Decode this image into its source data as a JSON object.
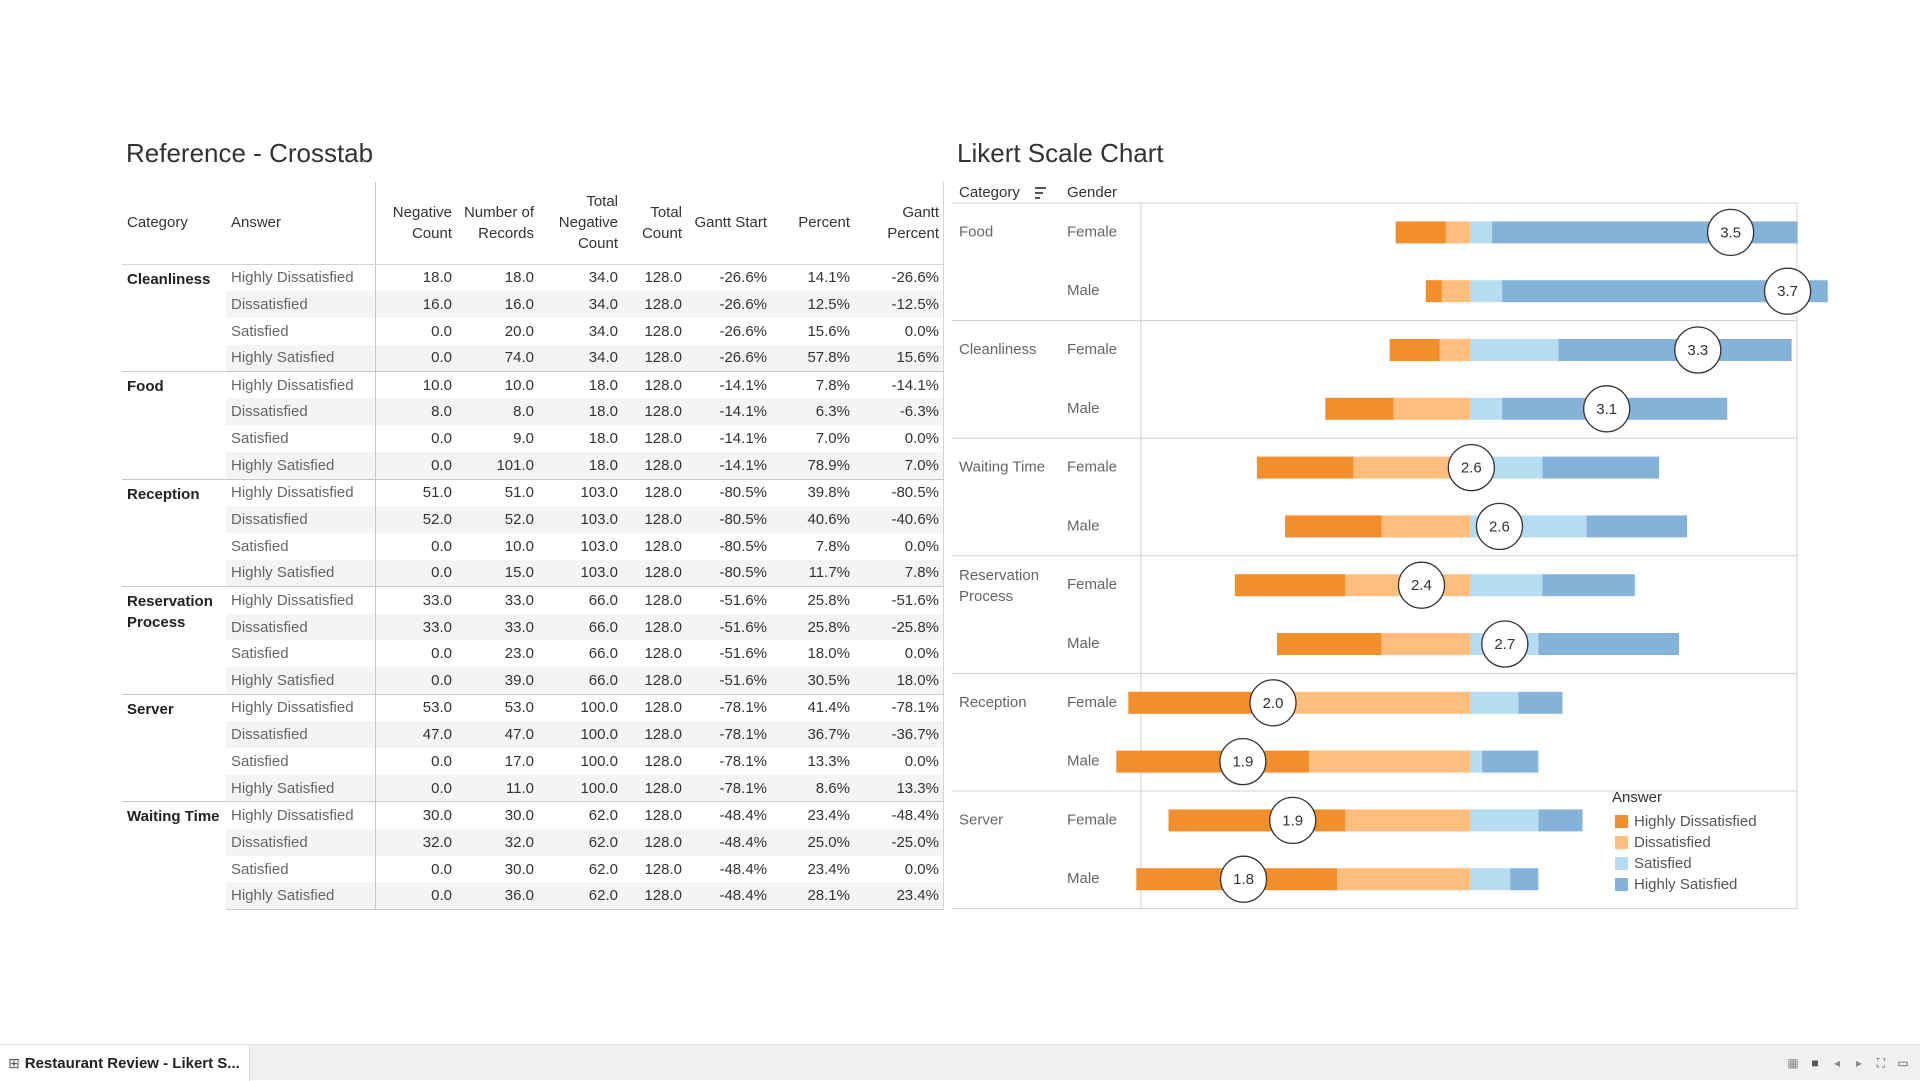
{
  "crosstab": {
    "title": "Reference - Crosstab",
    "headers": {
      "category": "Category",
      "answer": "Answer",
      "negative_count": "Negative Count",
      "number_of_records": "Number of Records",
      "total_negative_count": "Total Negative Count",
      "total_count": "Total Count",
      "gantt_start": "Gantt Start",
      "percent": "Percent",
      "gantt_percent": "Gantt Percent"
    },
    "groups": [
      {
        "category": "Cleanliness",
        "rows": [
          [
            "Highly Dissatisfied",
            "18.0",
            "18.0",
            "34.0",
            "128.0",
            "-26.6%",
            "14.1%",
            "-26.6%"
          ],
          [
            "Dissatisfied",
            "16.0",
            "16.0",
            "34.0",
            "128.0",
            "-26.6%",
            "12.5%",
            "-12.5%"
          ],
          [
            "Satisfied",
            "0.0",
            "20.0",
            "34.0",
            "128.0",
            "-26.6%",
            "15.6%",
            "0.0%"
          ],
          [
            "Highly Satisfied",
            "0.0",
            "74.0",
            "34.0",
            "128.0",
            "-26.6%",
            "57.8%",
            "15.6%"
          ]
        ]
      },
      {
        "category": "Food",
        "rows": [
          [
            "Highly Dissatisfied",
            "10.0",
            "10.0",
            "18.0",
            "128.0",
            "-14.1%",
            "7.8%",
            "-14.1%"
          ],
          [
            "Dissatisfied",
            "8.0",
            "8.0",
            "18.0",
            "128.0",
            "-14.1%",
            "6.3%",
            "-6.3%"
          ],
          [
            "Satisfied",
            "0.0",
            "9.0",
            "18.0",
            "128.0",
            "-14.1%",
            "7.0%",
            "0.0%"
          ],
          [
            "Highly Satisfied",
            "0.0",
            "101.0",
            "18.0",
            "128.0",
            "-14.1%",
            "78.9%",
            "7.0%"
          ]
        ]
      },
      {
        "category": "Reception",
        "rows": [
          [
            "Highly Dissatisfied",
            "51.0",
            "51.0",
            "103.0",
            "128.0",
            "-80.5%",
            "39.8%",
            "-80.5%"
          ],
          [
            "Dissatisfied",
            "52.0",
            "52.0",
            "103.0",
            "128.0",
            "-80.5%",
            "40.6%",
            "-40.6%"
          ],
          [
            "Satisfied",
            "0.0",
            "10.0",
            "103.0",
            "128.0",
            "-80.5%",
            "7.8%",
            "0.0%"
          ],
          [
            "Highly Satisfied",
            "0.0",
            "15.0",
            "103.0",
            "128.0",
            "-80.5%",
            "11.7%",
            "7.8%"
          ]
        ]
      },
      {
        "category": "Reservation Process",
        "rows": [
          [
            "Highly Dissatisfied",
            "33.0",
            "33.0",
            "66.0",
            "128.0",
            "-51.6%",
            "25.8%",
            "-51.6%"
          ],
          [
            "Dissatisfied",
            "33.0",
            "33.0",
            "66.0",
            "128.0",
            "-51.6%",
            "25.8%",
            "-25.8%"
          ],
          [
            "Satisfied",
            "0.0",
            "23.0",
            "66.0",
            "128.0",
            "-51.6%",
            "18.0%",
            "0.0%"
          ],
          [
            "Highly Satisfied",
            "0.0",
            "39.0",
            "66.0",
            "128.0",
            "-51.6%",
            "30.5%",
            "18.0%"
          ]
        ]
      },
      {
        "category": "Server",
        "rows": [
          [
            "Highly Dissatisfied",
            "53.0",
            "53.0",
            "100.0",
            "128.0",
            "-78.1%",
            "41.4%",
            "-78.1%"
          ],
          [
            "Dissatisfied",
            "47.0",
            "47.0",
            "100.0",
            "128.0",
            "-78.1%",
            "36.7%",
            "-36.7%"
          ],
          [
            "Satisfied",
            "0.0",
            "17.0",
            "100.0",
            "128.0",
            "-78.1%",
            "13.3%",
            "0.0%"
          ],
          [
            "Highly Satisfied",
            "0.0",
            "11.0",
            "100.0",
            "128.0",
            "-78.1%",
            "8.6%",
            "13.3%"
          ]
        ]
      },
      {
        "category": "Waiting Time",
        "rows": [
          [
            "Highly Dissatisfied",
            "30.0",
            "30.0",
            "62.0",
            "128.0",
            "-48.4%",
            "23.4%",
            "-48.4%"
          ],
          [
            "Dissatisfied",
            "32.0",
            "32.0",
            "62.0",
            "128.0",
            "-48.4%",
            "25.0%",
            "-25.0%"
          ],
          [
            "Satisfied",
            "0.0",
            "30.0",
            "62.0",
            "128.0",
            "-48.4%",
            "23.4%",
            "0.0%"
          ],
          [
            "Highly Satisfied",
            "0.0",
            "36.0",
            "62.0",
            "128.0",
            "-48.4%",
            "28.1%",
            "23.4%"
          ]
        ]
      }
    ]
  },
  "likert": {
    "title": "Likert Scale Chart",
    "col_category": "Category",
    "col_gender": "Gender",
    "legend_title": "Answer",
    "answers": [
      "Highly Dissatisfied",
      "Dissatisfied",
      "Satisfied",
      "Highly Satisfied"
    ],
    "colors": {
      "Highly Dissatisfied": "#f28e2b",
      "Dissatisfied": "#ffbe7d",
      "Satisfied": "#b5dcf0",
      "Highly Satisfied": "#85b2d8"
    },
    "chart_data": {
      "type": "bar",
      "stacked": "diverging",
      "x_unit": "percent of responses",
      "xlim": [
        -70,
        50
      ],
      "rows": [
        {
          "category": "Food",
          "gender": "Female",
          "score": "3.5",
          "segments": [
            -12.5,
            -6.0,
            -5.5,
            76.0
          ]
        },
        {
          "category": "Food",
          "gender": "Male",
          "score": "3.7",
          "segments": [
            -4.0,
            -7.0,
            -8.0,
            81.0
          ]
        },
        {
          "category": "Cleanliness",
          "gender": "Female",
          "score": "3.3",
          "segments": [
            -12.5,
            -7.5,
            -22.0,
            58.0
          ]
        },
        {
          "category": "Cleanliness",
          "gender": "Male",
          "score": "3.1",
          "segments": [
            -17.0,
            -19.0,
            -8.0,
            56.0
          ]
        },
        {
          "category": "Waiting Time",
          "gender": "Female",
          "score": "2.6",
          "segments": [
            -24.0,
            -29.0,
            -18.0,
            29.0
          ]
        },
        {
          "category": "Waiting Time",
          "gender": "Male",
          "score": "2.6",
          "segments": [
            -24.0,
            -22.0,
            -29.0,
            25.0
          ]
        },
        {
          "category": "Reservation Process",
          "gender": "Female",
          "score": "2.4",
          "segments": [
            -27.5,
            -31.0,
            -18.0,
            23.0
          ]
        },
        {
          "category": "Reservation Process",
          "gender": "Male",
          "score": "2.7",
          "segments": [
            -26.0,
            -22.0,
            -17.0,
            35.0
          ]
        },
        {
          "category": "Reception",
          "gender": "Female",
          "score": "2.0",
          "segments": [
            -40.0,
            -45.0,
            -12.0,
            11.0
          ]
        },
        {
          "category": "Reception",
          "gender": "Male",
          "score": "1.9",
          "segments": [
            -48.0,
            -40.0,
            -3.0,
            14.0
          ]
        },
        {
          "category": "Server",
          "gender": "Female",
          "score": "1.9",
          "segments": [
            -44.0,
            -31.0,
            -17.0,
            11.0
          ]
        },
        {
          "category": "Server",
          "gender": "Male",
          "score": "1.8",
          "segments": [
            -50.0,
            -33.0,
            -10.0,
            7.0
          ]
        }
      ]
    }
  },
  "tabbar": {
    "sheet_label": "Restaurant Review - Likert S...",
    "sheet_icon": "grid-icon"
  }
}
